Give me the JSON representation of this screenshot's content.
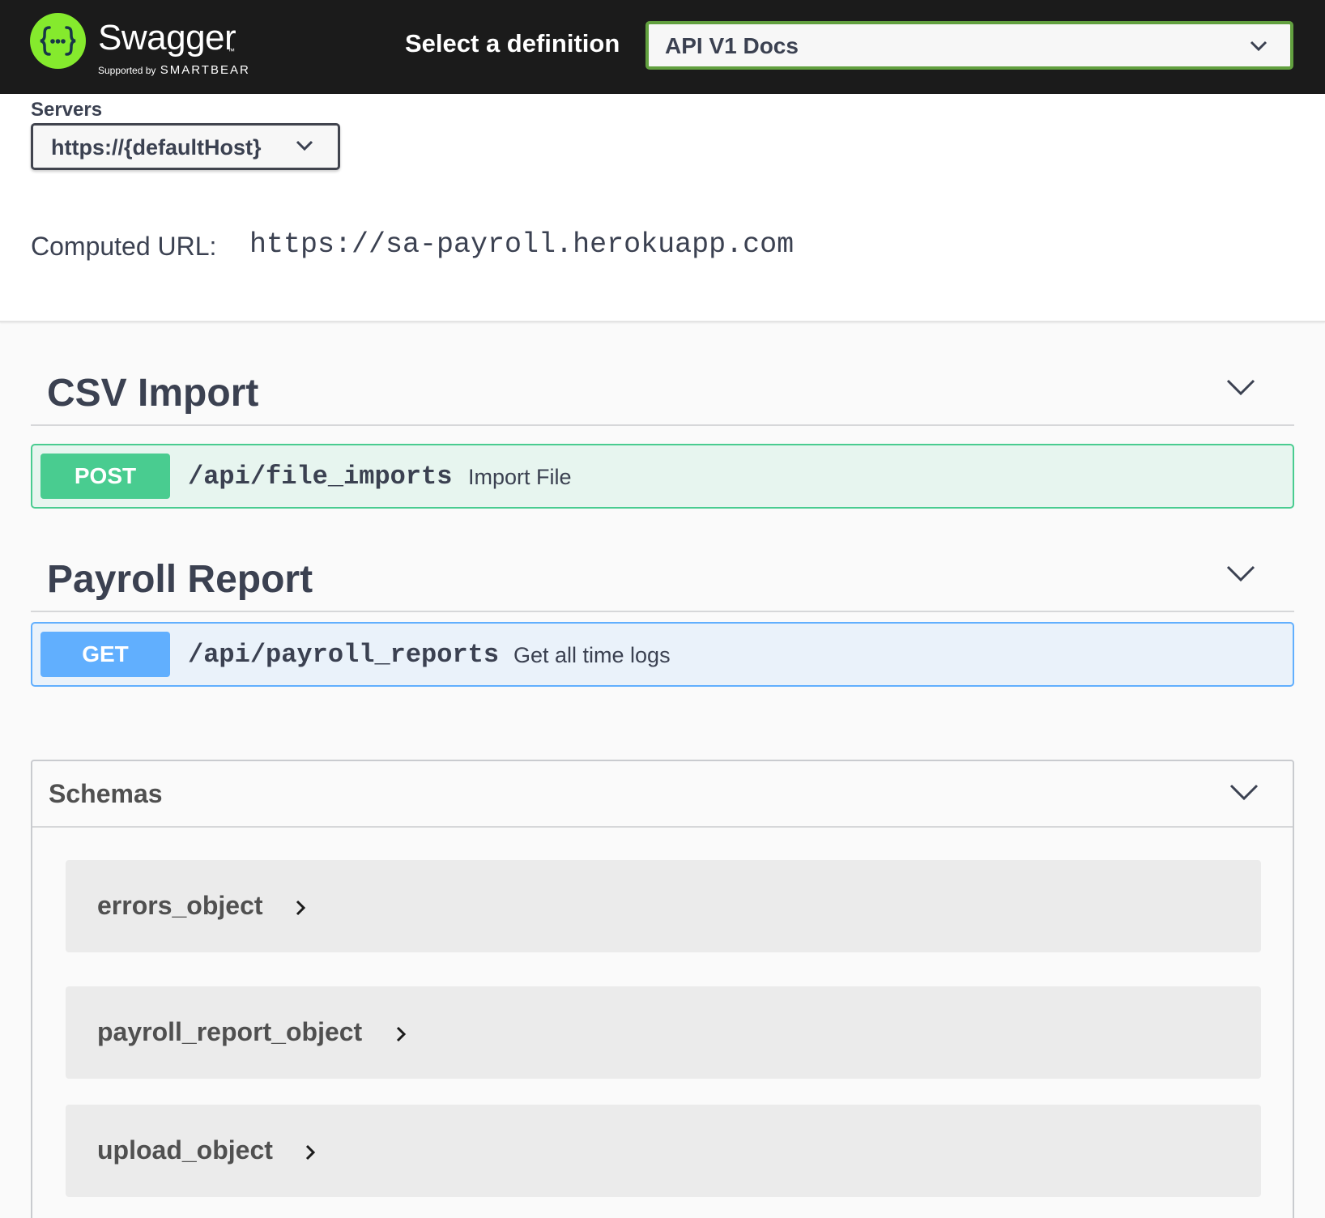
{
  "header": {
    "logo_word": "Swagger",
    "logo_tm": "™",
    "logo_supported": "Supported by",
    "logo_brand": "SMARTBEAR",
    "definition_label": "Select a definition",
    "definition_value": "API V1 Docs"
  },
  "servers": {
    "label": "Servers",
    "selected": "https://{defaultHost}",
    "computed_label": "Computed URL:",
    "computed_url": "https://sa-payroll.herokuapp.com"
  },
  "tags": [
    {
      "title": "CSV Import",
      "operation": {
        "method": "POST",
        "path": "/api/file_imports",
        "summary": "Import File"
      }
    },
    {
      "title": "Payroll Report",
      "operation": {
        "method": "GET",
        "path": "/api/payroll_reports",
        "summary": "Get all time logs"
      }
    }
  ],
  "schemas": {
    "title": "Schemas",
    "models": [
      "errors_object",
      "payroll_report_object",
      "upload_object"
    ]
  },
  "colors": {
    "topbar": "#1b1b1b",
    "logo_green": "#85ea2d",
    "select_border": "#62a03f",
    "post": "#49cc90",
    "get": "#61affe"
  },
  "icons": [
    "swagger-logo-icon",
    "chevron-down-icon",
    "chevron-right-icon"
  ]
}
